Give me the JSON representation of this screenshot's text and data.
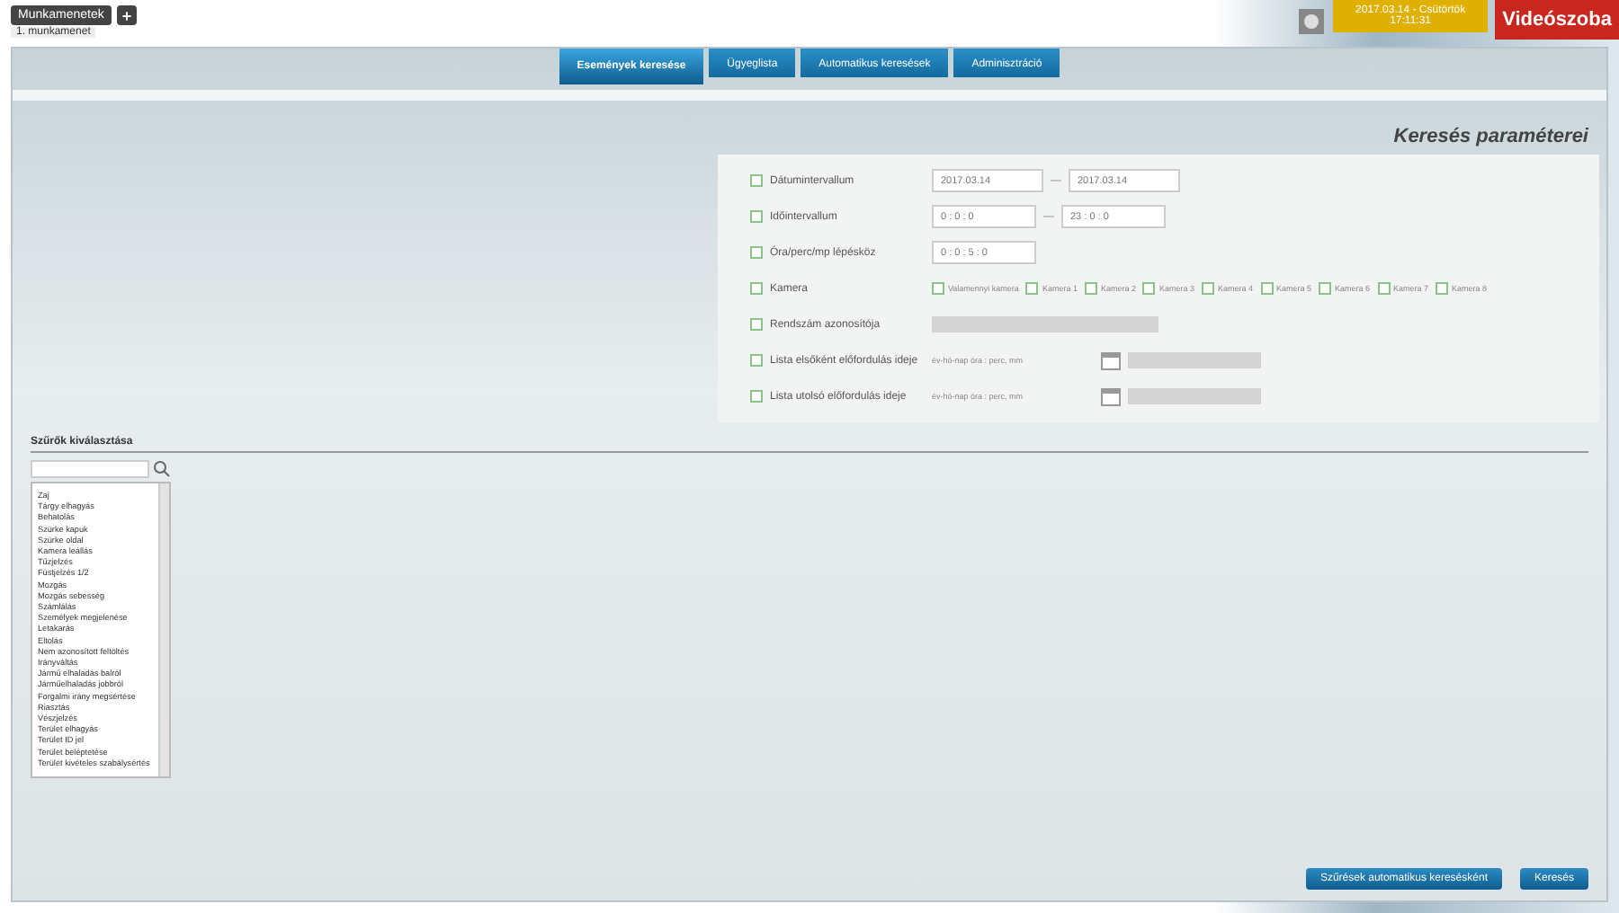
{
  "top_bar": {
    "new_session_button": "Munkamenetek",
    "add_icon": "+",
    "session_tab": "1. munkamenet",
    "clock": [
      "2017.03.14 - Csütörtök",
      "17:11:31"
    ],
    "video_room_button": "Videószoba"
  },
  "nav_tabs": [
    {
      "label": "Események keresése",
      "selected": true
    },
    {
      "label": "Ügyeglista",
      "selected": false
    },
    {
      "label": "Automatikus keresések",
      "selected": false
    },
    {
      "label": "Adminisztráció",
      "selected": false
    }
  ],
  "params": {
    "title": "Keresés paraméterei",
    "rows": [
      {
        "kind": "daterange",
        "label": "Dátumintervallum",
        "checked": false,
        "from": "2017.03.14",
        "to": "2017.03.14",
        "separator": "—"
      },
      {
        "kind": "timerange",
        "label": "Időintervallum",
        "checked": false,
        "from": "0 : 0 : 0",
        "to": "23 : 0 : 0",
        "separator": "—"
      },
      {
        "kind": "step",
        "label": "Óra/perc/mp lépésköz",
        "checked": false,
        "value": "0 : 0 : 5 : 0"
      },
      {
        "kind": "cameras",
        "label": "Kamera",
        "checked": false,
        "options": [
          {
            "label": "Valamennyi kamera",
            "checked": false
          },
          {
            "label": "Kamera 1",
            "checked": false
          },
          {
            "label": "Kamera 2",
            "checked": false
          },
          {
            "label": "Kamera 3",
            "checked": false
          },
          {
            "label": "Kamera 4",
            "checked": false
          },
          {
            "label": "Kamera 5",
            "checked": false
          },
          {
            "label": "Kamera 6",
            "checked": false
          },
          {
            "label": "Kamera 7",
            "checked": false
          },
          {
            "label": "Kamera 8",
            "checked": false
          }
        ]
      },
      {
        "kind": "text",
        "label": "Rendszám azonosítója",
        "checked": false
      },
      {
        "kind": "datetime",
        "label": "Lista elsőként előfordulás ideje",
        "checked": false,
        "placeholder": "év-hó-nap óra : perc, mm"
      },
      {
        "kind": "datetime",
        "label": "Lista utolsó előfordulás ideje",
        "checked": false,
        "placeholder": "év-hó-nap óra : perc, mm"
      }
    ]
  },
  "filters": {
    "title": "Szűrők kiválasztása",
    "items": [
      "Zaj",
      "Tárgy elhagyás",
      "Behatolás",
      "Szürke kapuk",
      "Szürke oldal",
      "Kamera leállás",
      "Tűzjelzés",
      "Füstjelzés 1/2",
      "Mozgás",
      "Mozgás sebesség",
      "Számlálás",
      "Személyek megjelenése",
      "Letakarás",
      "Eltolás",
      "Nem azonosított feltöltés",
      "Irányváltás",
      "Jármű elhaladás balról",
      "Járműelhaladás jobbról",
      "Forgalmi irány megsértése",
      "Riasztás",
      "Vészjelzés",
      "Terület elhagyás",
      "Terület ID jel",
      "Terület beléptetése",
      "Terület kivételes szabálysértés"
    ]
  },
  "footer": {
    "save_button": "Szűrések automatikus keresésként",
    "search_button": "Keresés"
  }
}
